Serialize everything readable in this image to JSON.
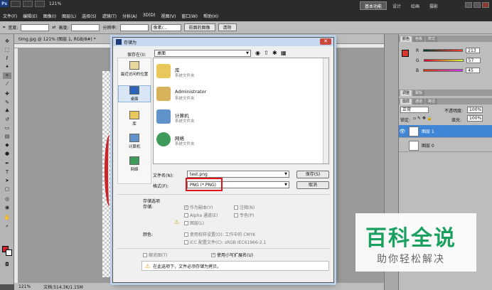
{
  "menubar": {
    "logo": "Ps",
    "zoom": "121%",
    "items": [
      "文件(F)",
      "编辑(E)",
      "图像(I)",
      "图层(L)",
      "选择(S)",
      "滤镜(T)",
      "分析(A)",
      "3D(D)",
      "视图(V)",
      "窗口(W)",
      "帮助(H)"
    ],
    "workspaces": [
      "基本功能",
      "设计",
      "绘画",
      "摄影"
    ]
  },
  "optbar": {
    "width_label": "宽度:",
    "height_label": "高度:",
    "resolution_label": "分辨率:",
    "unit": "像素/...",
    "front_image": "前面的图像",
    "clear": "清除"
  },
  "document": {
    "tab": "timg.jpg @ 121% (图层 1, RGB/8#) *",
    "status_zoom": "121%",
    "status_doc": "文档:514.3K/1.15M"
  },
  "dialog": {
    "title": "存储为",
    "save_in_label": "保存在(I):",
    "save_in_value": "桌面",
    "places": [
      "最近访问的位置",
      "桌面",
      "库",
      "计算机",
      "网络"
    ],
    "files": [
      {
        "name": "库",
        "desc": "系统文件夹"
      },
      {
        "name": "Administrator",
        "desc": "系统文件夹"
      },
      {
        "name": "计算机",
        "desc": "系统文件夹"
      },
      {
        "name": "网络",
        "desc": "系统文件夹"
      }
    ],
    "filename_label": "文件名(N):",
    "filename_value": "test.png",
    "format_label": "格式(F):",
    "format_value": "PNG (*.PNG)",
    "save_button": "保存(S)",
    "cancel_button": "取消",
    "save_options_title": "存储选项",
    "store_label": "存储:",
    "opt_copy": "作为副本(Y)",
    "opt_notes": "注释(N)",
    "opt_alpha": "Alpha 通道(E)",
    "opt_spot": "专色(P)",
    "opt_layers": "图层(L)",
    "color_label": "颜色:",
    "opt_proof": "使用校样设置(O): 工作中的 CMYK",
    "opt_icc": "ICC 配置文件(C): sRGB IEC61966-2.1",
    "opt_thumbnail": "缩览图(T)",
    "opt_lowercase": "使用小写扩展名(U)",
    "warning": "在此选项下，文件必须存储为拷贝。"
  },
  "color_panel": {
    "tabs": [
      "颜色",
      "色板",
      "样式"
    ],
    "r_label": "R",
    "r": "213",
    "g_label": "G",
    "g": "57",
    "b_label": "B",
    "b": "45",
    "fg_color": "#d5392d"
  },
  "adjust_panel": {
    "tabs": [
      "调整",
      "蒙版"
    ]
  },
  "layers_panel": {
    "tabs": [
      "图层",
      "通道",
      "路径"
    ],
    "blend": "正常",
    "opacity_label": "不透明度:",
    "opacity": "100%",
    "lock_label": "锁定:",
    "fill_label": "填充:",
    "fill": "100%",
    "layers": [
      "图层 1",
      "图层 0"
    ]
  },
  "watermark": {
    "main": "百科全说",
    "sub": "助你轻松解决"
  }
}
